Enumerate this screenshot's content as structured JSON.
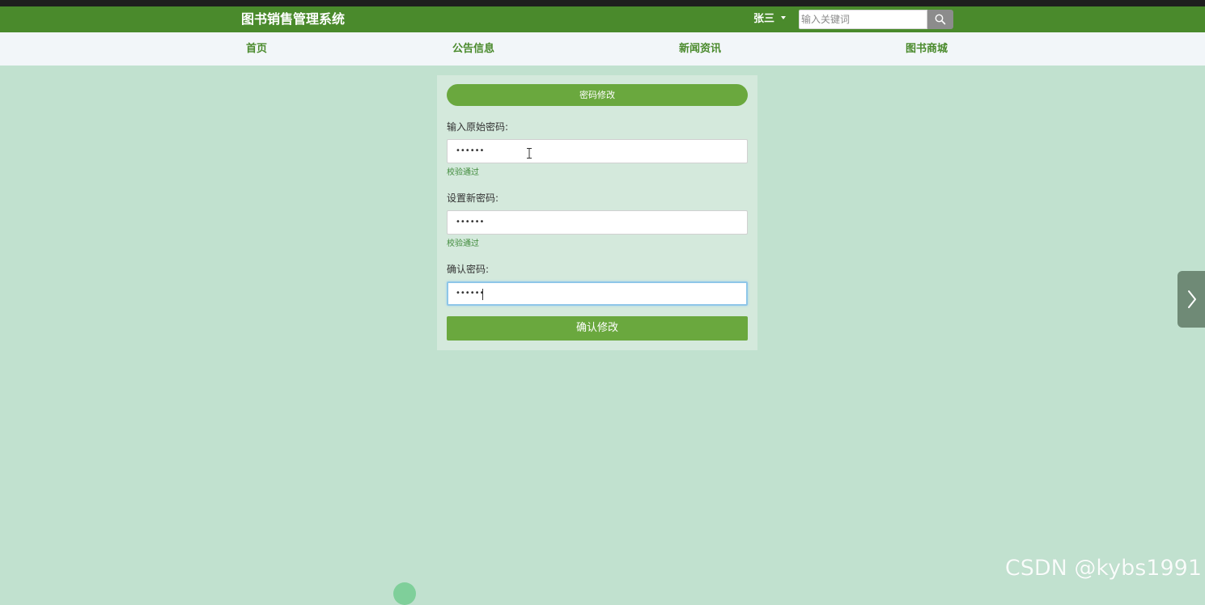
{
  "header": {
    "site_title": "图书销售管理系统",
    "user_name": "张三",
    "search_placeholder": "输入关键词"
  },
  "nav": {
    "items": [
      {
        "label": "首页"
      },
      {
        "label": "公告信息"
      },
      {
        "label": "新闻资讯"
      },
      {
        "label": "图书商城"
      }
    ]
  },
  "form": {
    "title": "密码修改",
    "fields": [
      {
        "label": "输入原始密码:",
        "value_masked": "••••••",
        "validation": "校验通过"
      },
      {
        "label": "设置新密码:",
        "value_masked": "••••••",
        "validation": "校验通过"
      },
      {
        "label": "确认密码:",
        "value_masked": "••••••"
      }
    ],
    "submit_label": "确认修改"
  },
  "watermark": "CSDN @kybs1991",
  "colors": {
    "header_green": "#4a8a2c",
    "button_green": "#6aa83e",
    "page_background": "#c1e1cf",
    "panel_background": "#d4e9dc",
    "validation_green": "#3f8a3a"
  },
  "icons": {
    "search": "search-icon",
    "dropdown": "caret-down-icon",
    "next": "chevron-right-icon"
  }
}
